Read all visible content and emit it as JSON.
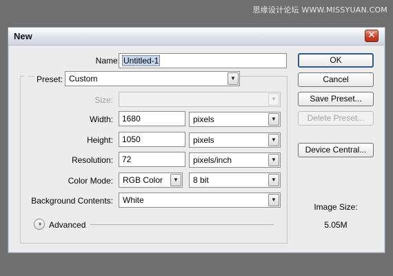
{
  "watermark": "思缘设计论坛 WWW.MISSYUAN.COM",
  "dialog": {
    "title": "New",
    "close_glyph": "✕",
    "name": {
      "label": "Name:",
      "value": "Untitled-1"
    },
    "preset": {
      "label": "Preset:",
      "value": "Custom"
    },
    "size": {
      "label": "Size:",
      "value": ""
    },
    "width": {
      "label": "Width:",
      "value": "1680",
      "unit": "pixels"
    },
    "height": {
      "label": "Height:",
      "value": "1050",
      "unit": "pixels"
    },
    "resolution": {
      "label": "Resolution:",
      "value": "72",
      "unit": "pixels/inch"
    },
    "color_mode": {
      "label": "Color Mode:",
      "value": "RGB Color",
      "bits": "8 bit"
    },
    "background_contents": {
      "label": "Background Contents:",
      "value": "White"
    },
    "advanced": {
      "label": "Advanced",
      "toggle_glyph": "»"
    },
    "arrow_glyph": "▼",
    "buttons": {
      "ok": "OK",
      "cancel": "Cancel",
      "save_preset": "Save Preset...",
      "delete_preset": "Delete Preset...",
      "device_central": "Device Central..."
    },
    "image_size": {
      "label": "Image Size:",
      "value": "5.05M"
    }
  }
}
